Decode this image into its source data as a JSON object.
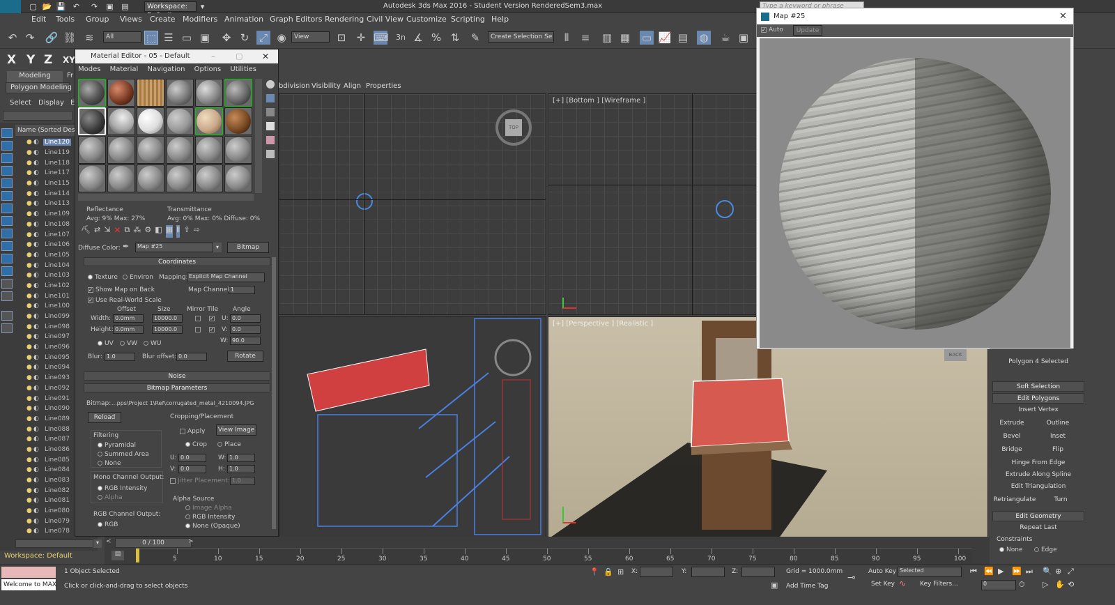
{
  "window": {
    "title": "Autodesk 3ds Max 2016 - Student Version      RenderedSem3.max",
    "workspace": "Workspace: Default",
    "search_placeholder": "Type a keyword or phrase"
  },
  "menu": [
    "Edit",
    "Tools",
    "Group",
    "Views",
    "Create",
    "Modifiers",
    "Animation",
    "Graph Editors",
    "Rendering",
    "Civil View",
    "Customize",
    "Scripting",
    "Help"
  ],
  "toolbar": {
    "filter": "All",
    "view": "View",
    "selection_set": "Create Selection Se",
    "snap_label": "3n"
  },
  "axes": [
    "X",
    "Y",
    "Z",
    "XY"
  ],
  "ribbon": {
    "tab_modeling": "Modeling",
    "tab_freeform": "Fr",
    "polygon_modeling": "Polygon Modeling",
    "n": "N"
  },
  "explorer": {
    "tab_select": "Select",
    "tab_display": "Display",
    "tab_edit": "E",
    "header": "Name (Sorted Descer",
    "items": [
      "Line120",
      "Line119",
      "Line118",
      "Line117",
      "Line115",
      "Line114",
      "Line113",
      "Line109",
      "Line108",
      "Line107",
      "Line106",
      "Line105",
      "Line104",
      "Line103",
      "Line102",
      "Line101",
      "Line100",
      "Line099",
      "Line098",
      "Line097",
      "Line096",
      "Line095",
      "Line094",
      "Line093",
      "Line092",
      "Line091",
      "Line090",
      "Line089",
      "Line088",
      "Line087",
      "Line086",
      "Line085",
      "Line084",
      "Line083",
      "Line082",
      "Line081",
      "Line080",
      "Line079",
      "Line078"
    ],
    "workspace": "Workspace: Default"
  },
  "viewport_tabs": [
    "bdivision",
    "Visibility",
    "Align",
    "Properties"
  ],
  "viewports": {
    "top_right_label": "[+] [Bottom ] [Wireframe ]",
    "bottom_right_label": "[+] [Perspective ] [Realistic ]",
    "cube_top": "TOP",
    "cube_back": "BACK"
  },
  "material_editor": {
    "title": "Material Editor - 05 - Default",
    "menu": [
      "Modes",
      "Material",
      "Navigation",
      "Options",
      "Utilities"
    ],
    "reflectance": {
      "label": "Reflectance",
      "values": "Avg:  9% Max: 27%"
    },
    "transmittance": {
      "label": "Transmittance",
      "values": "Avg:  0% Max:  0%  Diffuse:  0%"
    },
    "diffuse_label": "Diffuse Color:",
    "map_name": "Map #25",
    "map_type": "Bitmap",
    "coordinates": {
      "title": "Coordinates",
      "texture": "Texture",
      "environ": "Environ",
      "mapping_label": "Mapping:",
      "mapping_value": "Explicit Map Channel",
      "show_map": "Show Map on Back",
      "map_channel_label": "Map Channel:",
      "map_channel_value": "1",
      "real_world": "Use Real-World Scale",
      "offset": "Offset",
      "size": "Size",
      "mirror_tile": "Mirror Tile",
      "angle": "Angle",
      "width_label": "Width:",
      "width_offset": "0.0mm",
      "width_size": "10000.0",
      "height_label": "Height:",
      "height_offset": "0.0mm",
      "height_size": "10000.0",
      "u_label": "U:",
      "u_angle": "0.0",
      "v_label": "V:",
      "v_angle": "0.0",
      "w_label": "W:",
      "w_angle": "90.0",
      "uv": "UV",
      "vw": "VW",
      "wu": "WU",
      "blur_label": "Blur:",
      "blur_value": "1.0",
      "blur_offset_label": "Blur offset:",
      "blur_offset_value": "0.0",
      "rotate": "Rotate"
    },
    "noise": "Noise",
    "bitmap_params": {
      "title": "Bitmap Parameters",
      "bitmap_label": "Bitmap:",
      "bitmap_path": "...pps\\Project 1\\Ref\\corrugated_metal_4210094.JPG",
      "reload": "Reload",
      "cropping": "Cropping/Placement",
      "apply": "Apply",
      "view_image": "View Image",
      "crop": "Crop",
      "place": "Place",
      "u_label": "U:",
      "u_value": "0.0",
      "w_label": "W:",
      "w_value": "1.0",
      "v_label": "V:",
      "v_value": "0.0",
      "h_label": "H:",
      "h_value": "1.0",
      "jitter": "Jitter Placement:",
      "jitter_value": "1.0",
      "filtering": "Filtering",
      "pyramidal": "Pyramidal",
      "summed_area": "Summed Area",
      "none": "None",
      "mono_output": "Mono Channel Output:",
      "rgb_intensity": "RGB Intensity",
      "alpha": "Alpha",
      "rgb_output": "RGB Channel Output:",
      "rgb": "RGB",
      "alpha_source": "Alpha Source",
      "image_alpha": "Image Alpha",
      "rgb_intensity2": "RGB Intensity",
      "none_opaque": "None (Opaque)"
    }
  },
  "map_window": {
    "title": "Map #25",
    "auto": "Auto",
    "update": "Update"
  },
  "command_panel": {
    "polygon_selected": "Polygon 4 Selected",
    "soft_selection": "Soft Selection",
    "edit_polygons": "Edit Polygons",
    "insert_vertex": "Insert Vertex",
    "extrude": "Extrude",
    "outline": "Outline",
    "bevel": "Bevel",
    "inset": "Inset",
    "bridge": "Bridge",
    "flip": "Flip",
    "hinge": "Hinge From Edge",
    "extrude_spline": "Extrude Along Spline",
    "edit_triangulation": "Edit Triangulation",
    "retriangulate": "Retriangulate",
    "turn": "Turn",
    "edit_geometry": "Edit Geometry",
    "repeat_last": "Repeat Last",
    "constraints": "Constraints",
    "none": "None",
    "edge": "Edge"
  },
  "timeline": {
    "frame": "0 / 100",
    "ticks": [
      "5",
      "10",
      "15",
      "20",
      "25",
      "30",
      "35",
      "40",
      "45",
      "50",
      "55",
      "60",
      "65",
      "70",
      "75",
      "80",
      "85",
      "90",
      "95",
      "100"
    ]
  },
  "status": {
    "welcome": "Welcome to MAX",
    "selected": "1 Object Selected",
    "hint": "Click or click-and-drag to select objects",
    "x_label": "X:",
    "y_label": "Y:",
    "z_label": "Z:",
    "grid": "Grid = 1000.0mm",
    "add_time_tag": "Add Time Tag",
    "auto_key": "Auto Key",
    "selected_drop": "Selected",
    "set_key": "Set Key",
    "key_filters": "Key Filters...",
    "frame_field": "0"
  }
}
